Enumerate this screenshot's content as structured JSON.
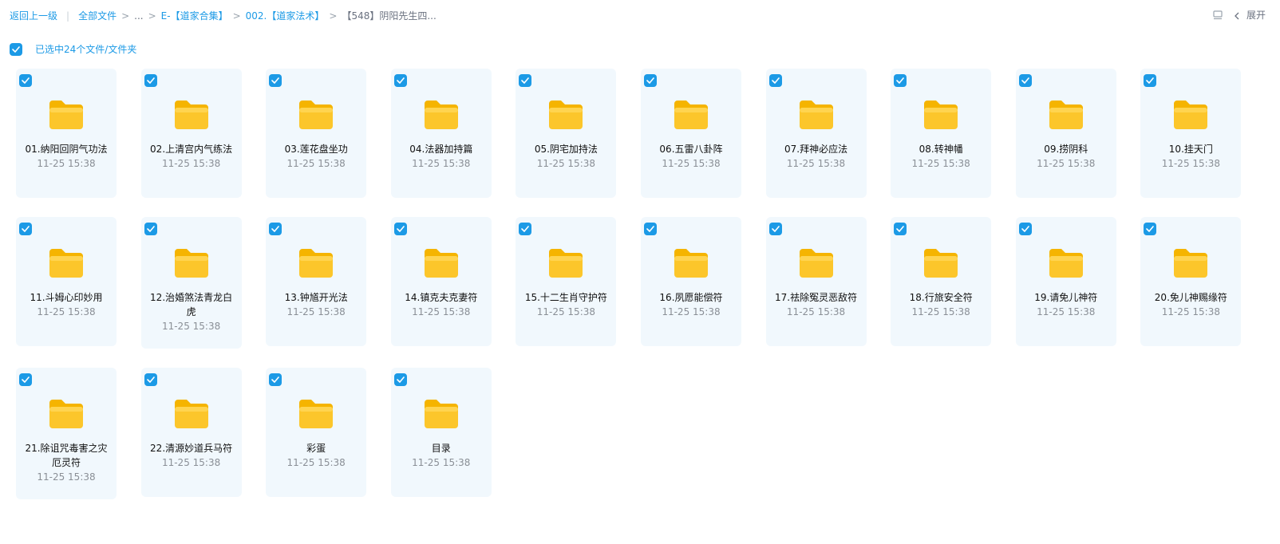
{
  "breadcrumb": {
    "back": "返回上一级",
    "all_files": "全部文件",
    "ellipsis": "...",
    "level1": "E-【道家合集】",
    "level2": "002.【道家法术】",
    "current": "【548】阴阳先生四..."
  },
  "toolbar": {
    "layout_icon": "layout-icon",
    "expand_label": "展开"
  },
  "selection": {
    "label": "已选中24个文件/文件夹",
    "checked": true
  },
  "colors": {
    "accent": "#1c9ae6",
    "tile_bg": "#f1f8fd",
    "folder": "#fcc62b"
  },
  "files": [
    {
      "name": "01.纳阳回阴气功法",
      "time": "11-25 15:38",
      "icon": "folder-icon"
    },
    {
      "name": "02.上清宫内气练法",
      "time": "11-25 15:38",
      "icon": "folder-icon"
    },
    {
      "name": "03.莲花盘坐功",
      "time": "11-25 15:38",
      "icon": "folder-icon"
    },
    {
      "name": "04.法器加持篇",
      "time": "11-25 15:38",
      "icon": "folder-icon"
    },
    {
      "name": "05.阴宅加持法",
      "time": "11-25 15:38",
      "icon": "folder-icon"
    },
    {
      "name": "06.五雷八卦阵",
      "time": "11-25 15:38",
      "icon": "folder-icon"
    },
    {
      "name": "07.拜神必应法",
      "time": "11-25 15:38",
      "icon": "folder-icon"
    },
    {
      "name": "08.转神幡",
      "time": "11-25 15:38",
      "icon": "folder-icon"
    },
    {
      "name": "09.捞阴科",
      "time": "11-25 15:38",
      "icon": "folder-icon"
    },
    {
      "name": "10.挂天门",
      "time": "11-25 15:38",
      "icon": "folder-icon"
    },
    {
      "name": "11.斗姆心印妙用",
      "time": "11-25 15:38",
      "icon": "folder-icon"
    },
    {
      "name": "12.治婚煞法青龙白虎",
      "time": "11-25 15:38",
      "icon": "folder-icon"
    },
    {
      "name": "13.钟馗开光法",
      "time": "11-25 15:38",
      "icon": "folder-icon"
    },
    {
      "name": "14.镇克夫克妻符",
      "time": "11-25 15:38",
      "icon": "folder-icon"
    },
    {
      "name": "15.十二生肖守护符",
      "time": "11-25 15:38",
      "icon": "folder-icon"
    },
    {
      "name": "16.夙愿能偿符",
      "time": "11-25 15:38",
      "icon": "folder-icon"
    },
    {
      "name": "17.祛除冤灵恶敌符",
      "time": "11-25 15:38",
      "icon": "folder-icon"
    },
    {
      "name": "18.行旅安全符",
      "time": "11-25 15:38",
      "icon": "folder-icon"
    },
    {
      "name": "19.请免儿神符",
      "time": "11-25 15:38",
      "icon": "folder-icon"
    },
    {
      "name": "20.免儿神赐缘符",
      "time": "11-25 15:38",
      "icon": "folder-icon"
    },
    {
      "name": "21.除诅咒毒害之灾厄灵符",
      "time": "11-25 15:38",
      "icon": "folder-icon"
    },
    {
      "name": "22.清源妙道兵马符",
      "time": "11-25 15:38",
      "icon": "folder-icon"
    },
    {
      "name": "彩蛋",
      "time": "11-25 15:38",
      "icon": "folder-icon"
    },
    {
      "name": "目录",
      "time": "11-25 15:38",
      "icon": "folder-icon"
    }
  ]
}
